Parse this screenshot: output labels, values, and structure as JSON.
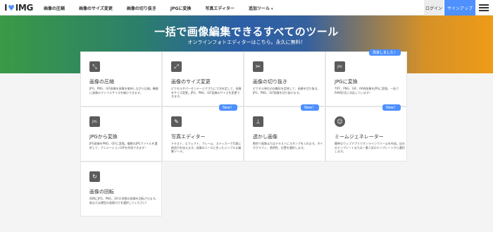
{
  "header": {
    "logo_text_left": "I",
    "logo_heart": "♥",
    "logo_text_right": "IMG",
    "nav": [
      {
        "label": "画像の圧縮"
      },
      {
        "label": "画像のサイズ変更"
      },
      {
        "label": "画像の切り抜き"
      },
      {
        "label": "JPGに変換"
      },
      {
        "label": "写真エディター"
      },
      {
        "label": "追加ツール",
        "caret": "▾"
      }
    ],
    "login_label": "ログイン",
    "signup_label": "サインアップ"
  },
  "hero": {
    "title": "一括で画像編集できるすべてのツール",
    "subtitle": "オンラインフォトエディターはこちら。永久に無料！"
  },
  "tools": [
    {
      "title": "画像の圧縮",
      "desc": "JPG、PNG、GIF画像を高質を維持しながら圧縮。機能に画像のファイルサイズを縮小できます。",
      "icon": "compress-icon",
      "glyph": "⤡",
      "badge": ""
    },
    {
      "title": "画像のサイズ変更",
      "desc": "ピクセルやパーセンテージで寸たに寸法を定して、画像をサイズ変更。JPG、PNG、GIF画像のサイズを変更できます。",
      "icon": "resize-icon",
      "glyph": "⤢",
      "badge": ""
    },
    {
      "title": "画像の切り抜き",
      "desc": "ピクセル単位の自動形を定修して、画像を切り抜き。JPG、PNG、GIF画像を切り抜けます。",
      "icon": "scissors-icon",
      "glyph": "✂",
      "badge": ""
    },
    {
      "title": "JPGに変換",
      "desc": "TIFF、PNG、GIF、RAW画像をJPGに変換。一括でRAW形式に対応しています！",
      "icon": "jpg-icon",
      "glyph": "JPG",
      "badge": "改良しました！"
    },
    {
      "title": "JPGから変換",
      "desc": "JPG画像をPNG、GIFに変換。複数のJPGファイルを選択して、アニメーションGIFを作成できます！",
      "icon": "jpg-convert-icon",
      "glyph": "JPG",
      "badge": ""
    },
    {
      "title": "写真エディター",
      "desc": "テキスト、エフェクト、フレーム、ステッカーで写真に創造力を加えます。画像のニーズに合ったシンプルな編集ツール。",
      "icon": "pencil-icon",
      "glyph": "✎",
      "badge": "New！"
    },
    {
      "title": "透かし画像",
      "desc": "数秒で画像またはテキストにスタンプを入れます。タイポグラフィ、透明性、位置を選択します。",
      "icon": "stamp-icon",
      "glyph": "⊥",
      "badge": "New！"
    },
    {
      "title": "ミームジェネレーター",
      "desc": "簡単なウェブアプリでオンラインでミームを作成。自分のテンプレートまたは一番人気のテンプレートから選択します。",
      "icon": "meme-icon",
      "glyph": "☺",
      "badge": "New！"
    },
    {
      "title": "画像の回転",
      "desc": "同時にJPG、PNG、GIFの多数の画像を回転させます。縦または横型の画像だけを選択してください！",
      "icon": "rotate-icon",
      "glyph": "↻",
      "badge": ""
    }
  ]
}
